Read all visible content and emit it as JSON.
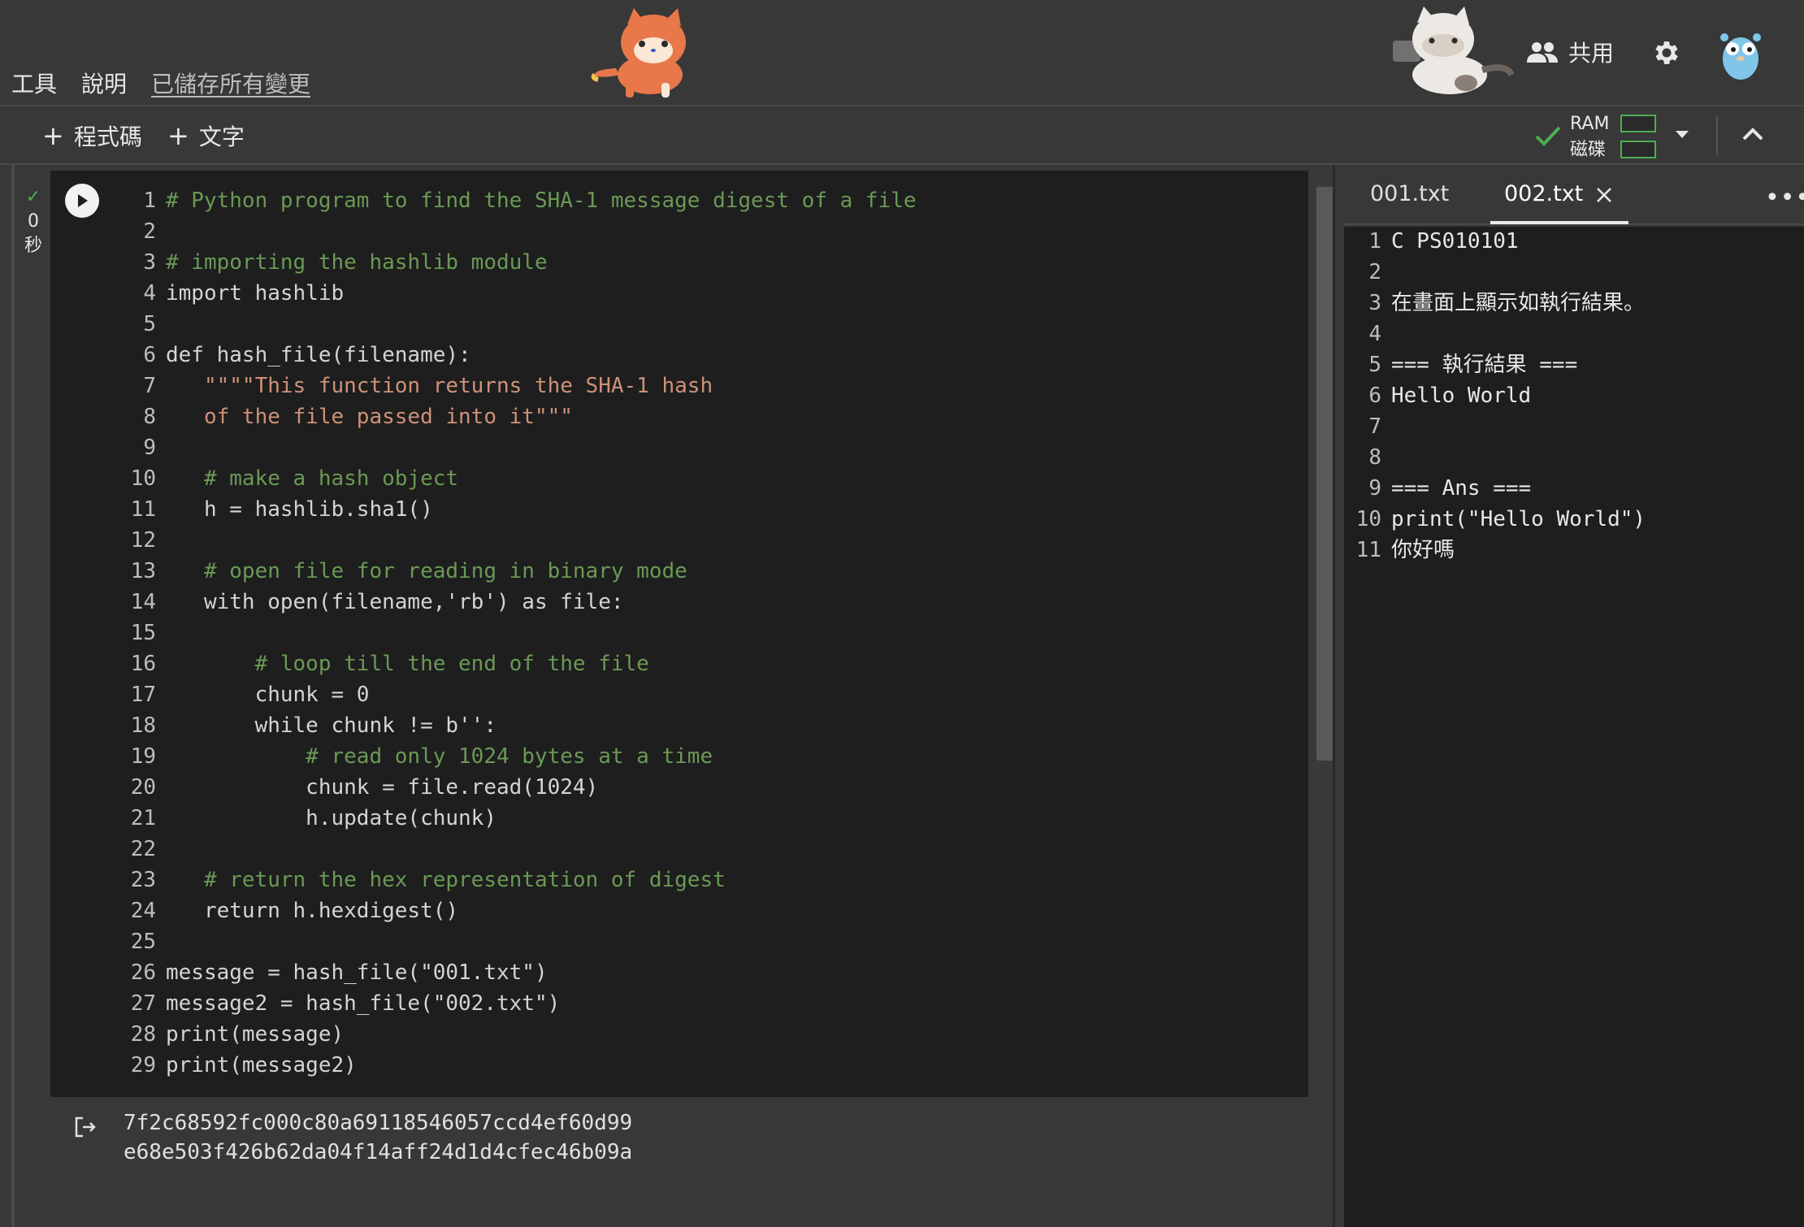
{
  "menu": {
    "tools": "工具",
    "help": "說明",
    "saved": "已儲存所有變更"
  },
  "header": {
    "share_label": "共用"
  },
  "toolbar": {
    "add_code": "程式碼",
    "add_text": "文字",
    "ram_label": "RAM",
    "disk_label": "磁碟"
  },
  "cell": {
    "status_check": "✓",
    "status_time": "0",
    "status_unit": "秒",
    "code_lines": [
      "# Python program to find the SHA-1 message digest of a file",
      "",
      "# importing the hashlib module",
      "import hashlib",
      "",
      "def hash_file(filename):",
      "   \"\"\"\"This function returns the SHA-1 hash",
      "   of the file passed into it\"\"\"",
      "",
      "   # make a hash object",
      "   h = hashlib.sha1()",
      "",
      "   # open file for reading in binary mode",
      "   with open(filename,'rb') as file:",
      "",
      "       # loop till the end of the file",
      "       chunk = 0",
      "       while chunk != b'':",
      "           # read only 1024 bytes at a time",
      "           chunk = file.read(1024)",
      "           h.update(chunk)",
      "",
      "   # return the hex representation of digest",
      "   return h.hexdigest()",
      "",
      "message = hash_file(\"001.txt\")",
      "message2 = hash_file(\"002.txt\")",
      "print(message)",
      "print(message2)"
    ],
    "output": [
      "7f2c68592fc000c80a69118546057ccd4ef60d99",
      "e68e503f426b62da04f14aff24d1d4cfec46b09a"
    ]
  },
  "file_panel": {
    "tabs": [
      "001.txt",
      "002.txt"
    ],
    "active_tab": "002.txt",
    "lines": [
      "C PS010101",
      "",
      "在畫面上顯示如執行結果。",
      "",
      "=== 執行結果 ===",
      "Hello World",
      "",
      "",
      "=== Ans ===",
      "print(\"Hello World\")",
      "你好嗎"
    ]
  },
  "colors": {
    "accent_green": "#4caf50",
    "comment": "#6a9955",
    "keyword": "#c586c0",
    "string": "#ce9178"
  }
}
